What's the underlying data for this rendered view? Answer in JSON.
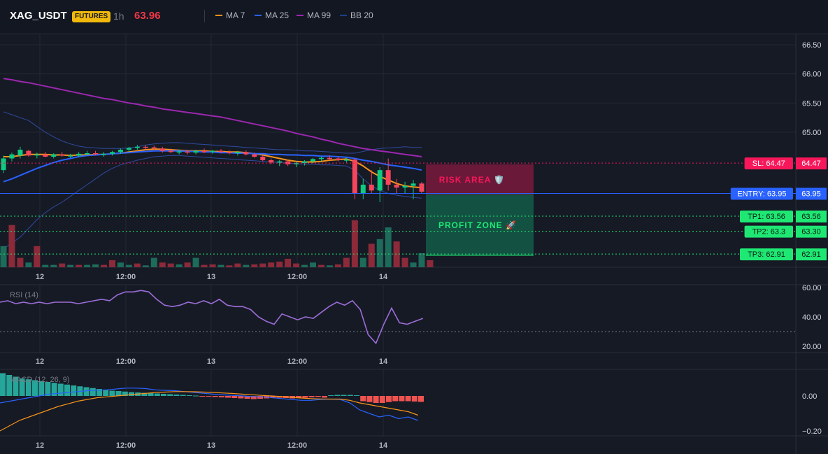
{
  "header": {
    "symbol": "XAG_USDT",
    "badge": "FUTURES",
    "timeframe": "1h",
    "price": "63.96",
    "legend": [
      {
        "label": "MA 7",
        "color": "#f7931a"
      },
      {
        "label": "MA 25",
        "color": "#2962ff"
      },
      {
        "label": "MA 99",
        "color": "#9c27b0"
      },
      {
        "label": "BB 20",
        "color": "#1e3f8a"
      }
    ]
  },
  "overlays": {
    "risk_label": "RISK AREA 🛡️",
    "profit_label": "PROFIT ZONE 🚀"
  },
  "levels": [
    {
      "label": "SL: 64.47",
      "price_label": "64.47",
      "value": 64.47,
      "color": "#f7175a"
    },
    {
      "label": "ENTRY: 63.95",
      "price_label": "63.95",
      "value": 63.95,
      "color": "#2962ff"
    },
    {
      "label": "TP1: 63.56",
      "price_label": "63.56",
      "value": 63.56,
      "color": "#1ee873"
    },
    {
      "label": "TP2: 63.3",
      "price_label": "63.30",
      "value": 63.3,
      "color": "#1ee873"
    },
    {
      "label": "TP3: 62.91",
      "price_label": "62.91",
      "value": 62.91,
      "color": "#1ee873"
    }
  ],
  "chart_data": [
    {
      "type": "candlestick",
      "title": "XAG_USDT 1h",
      "y_ticks": [
        "66.50",
        "66.00",
        "65.50",
        "65.00"
      ],
      "x_ticks": [
        "12",
        "12:00",
        "13",
        "12:00",
        "14"
      ],
      "ylim": [
        62.9,
        66.7
      ],
      "candles": [
        {
          "o": 64.35,
          "h": 64.6,
          "l": 64.3,
          "c": 64.55
        },
        {
          "o": 64.55,
          "h": 64.65,
          "l": 64.5,
          "c": 64.62
        },
        {
          "o": 64.6,
          "h": 64.75,
          "l": 64.55,
          "c": 64.7
        },
        {
          "o": 64.68,
          "h": 64.7,
          "l": 64.58,
          "c": 64.6
        },
        {
          "o": 64.6,
          "h": 64.65,
          "l": 64.55,
          "c": 64.62
        },
        {
          "o": 64.62,
          "h": 64.66,
          "l": 64.57,
          "c": 64.58
        },
        {
          "o": 64.58,
          "h": 64.64,
          "l": 64.55,
          "c": 64.62
        },
        {
          "o": 64.62,
          "h": 64.66,
          "l": 64.58,
          "c": 64.6
        },
        {
          "o": 64.6,
          "h": 64.63,
          "l": 64.56,
          "c": 64.6
        },
        {
          "o": 64.6,
          "h": 64.66,
          "l": 64.57,
          "c": 64.63
        },
        {
          "o": 64.63,
          "h": 64.68,
          "l": 64.6,
          "c": 64.64
        },
        {
          "o": 64.64,
          "h": 64.68,
          "l": 64.6,
          "c": 64.62
        },
        {
          "o": 64.62,
          "h": 64.66,
          "l": 64.58,
          "c": 64.63
        },
        {
          "o": 64.63,
          "h": 64.68,
          "l": 64.6,
          "c": 64.66
        },
        {
          "o": 64.66,
          "h": 64.72,
          "l": 64.63,
          "c": 64.7
        },
        {
          "o": 64.7,
          "h": 64.75,
          "l": 64.66,
          "c": 64.73
        },
        {
          "o": 64.73,
          "h": 64.78,
          "l": 64.7,
          "c": 64.75
        },
        {
          "o": 64.75,
          "h": 64.78,
          "l": 64.7,
          "c": 64.74
        },
        {
          "o": 64.74,
          "h": 64.77,
          "l": 64.7,
          "c": 64.72
        },
        {
          "o": 64.72,
          "h": 64.75,
          "l": 64.65,
          "c": 64.68
        },
        {
          "o": 64.68,
          "h": 64.72,
          "l": 64.64,
          "c": 64.66
        },
        {
          "o": 64.66,
          "h": 64.7,
          "l": 64.62,
          "c": 64.67
        },
        {
          "o": 64.67,
          "h": 64.7,
          "l": 64.62,
          "c": 64.65
        },
        {
          "o": 64.65,
          "h": 64.7,
          "l": 64.62,
          "c": 64.68
        },
        {
          "o": 64.68,
          "h": 64.72,
          "l": 64.64,
          "c": 64.66
        },
        {
          "o": 64.66,
          "h": 64.7,
          "l": 64.63,
          "c": 64.68
        },
        {
          "o": 64.68,
          "h": 64.71,
          "l": 64.64,
          "c": 64.66
        },
        {
          "o": 64.66,
          "h": 64.69,
          "l": 64.62,
          "c": 64.64
        },
        {
          "o": 64.64,
          "h": 64.68,
          "l": 64.6,
          "c": 64.66
        },
        {
          "o": 64.66,
          "h": 64.69,
          "l": 64.6,
          "c": 64.62
        },
        {
          "o": 64.62,
          "h": 64.65,
          "l": 64.56,
          "c": 64.58
        },
        {
          "o": 64.58,
          "h": 64.6,
          "l": 64.5,
          "c": 64.52
        },
        {
          "o": 64.52,
          "h": 64.55,
          "l": 64.45,
          "c": 64.48
        },
        {
          "o": 64.48,
          "h": 64.52,
          "l": 64.42,
          "c": 64.5
        },
        {
          "o": 64.5,
          "h": 64.53,
          "l": 64.42,
          "c": 64.45
        },
        {
          "o": 64.45,
          "h": 64.5,
          "l": 64.4,
          "c": 64.47
        },
        {
          "o": 64.47,
          "h": 64.52,
          "l": 64.43,
          "c": 64.5
        },
        {
          "o": 64.5,
          "h": 64.56,
          "l": 64.47,
          "c": 64.54
        },
        {
          "o": 64.54,
          "h": 64.58,
          "l": 64.5,
          "c": 64.56
        },
        {
          "o": 64.56,
          "h": 64.6,
          "l": 64.52,
          "c": 64.55
        },
        {
          "o": 64.55,
          "h": 64.58,
          "l": 64.5,
          "c": 64.52
        },
        {
          "o": 64.52,
          "h": 64.56,
          "l": 64.48,
          "c": 64.53
        },
        {
          "o": 64.53,
          "h": 64.55,
          "l": 63.85,
          "c": 63.95
        },
        {
          "o": 63.95,
          "h": 64.2,
          "l": 63.85,
          "c": 64.1
        },
        {
          "o": 64.1,
          "h": 64.35,
          "l": 63.95,
          "c": 64.0
        },
        {
          "o": 64.0,
          "h": 64.4,
          "l": 63.8,
          "c": 64.35
        },
        {
          "o": 64.35,
          "h": 64.55,
          "l": 64.0,
          "c": 64.1
        },
        {
          "o": 64.1,
          "h": 64.2,
          "l": 63.95,
          "c": 64.05
        },
        {
          "o": 64.05,
          "h": 64.15,
          "l": 63.95,
          "c": 64.08
        },
        {
          "o": 64.08,
          "h": 64.18,
          "l": 63.85,
          "c": 64.12
        },
        {
          "o": 64.12,
          "h": 64.15,
          "l": 63.95,
          "c": 63.98
        }
      ],
      "series": [
        {
          "name": "MA 7",
          "values": [
            64.58,
            64.58,
            64.6,
            64.62,
            64.62,
            64.62,
            64.61,
            64.61,
            64.6,
            64.61,
            64.61,
            64.62,
            64.62,
            64.63,
            64.64,
            64.66,
            64.68,
            64.7,
            64.71,
            64.71,
            64.7,
            64.69,
            64.68,
            64.68,
            64.68,
            64.67,
            64.67,
            64.66,
            64.66,
            64.65,
            64.63,
            64.61,
            64.58,
            64.55,
            64.52,
            64.5,
            64.49,
            64.49,
            64.5,
            64.52,
            64.53,
            64.54,
            64.5,
            64.42,
            64.32,
            64.24,
            64.18,
            64.12,
            64.08,
            64.06,
            64.05
          ]
        },
        {
          "name": "MA 25",
          "values": [
            64.15,
            64.2,
            64.26,
            64.32,
            64.38,
            64.43,
            64.48,
            64.52,
            64.55,
            64.58,
            64.6,
            64.61,
            64.62,
            64.63,
            64.64,
            64.65,
            64.66,
            64.67,
            64.68,
            64.68,
            64.68,
            64.68,
            64.67,
            64.67,
            64.66,
            64.66,
            64.65,
            64.65,
            64.64,
            64.64,
            64.63,
            64.63,
            64.62,
            64.62,
            64.61,
            64.61,
            64.6,
            64.6,
            64.59,
            64.59,
            64.58,
            64.57,
            64.55,
            64.52,
            64.5,
            64.47,
            64.44,
            64.42,
            64.4,
            64.38,
            64.35
          ]
        },
        {
          "name": "MA 99",
          "values": [
            65.92,
            65.9,
            65.87,
            65.85,
            65.82,
            65.79,
            65.76,
            65.73,
            65.7,
            65.67,
            65.64,
            65.61,
            65.58,
            65.56,
            65.53,
            65.5,
            65.48,
            65.45,
            65.43,
            65.4,
            65.38,
            65.36,
            65.34,
            65.32,
            65.3,
            65.28,
            65.26,
            65.23,
            65.2,
            65.17,
            65.14,
            65.11,
            65.08,
            65.05,
            65.02,
            64.98,
            64.95,
            64.92,
            64.88,
            64.85,
            64.81,
            64.78,
            64.75,
            64.72,
            64.7,
            64.68,
            64.66,
            64.64,
            64.62,
            64.6,
            64.58
          ]
        },
        {
          "name": "BB 20 upper",
          "values": [
            65.35,
            65.3,
            65.25,
            65.2,
            65.1,
            65.0,
            64.92,
            64.85,
            64.8,
            64.76,
            64.74,
            64.73,
            64.72,
            64.72,
            64.72,
            64.73,
            64.75,
            64.78,
            64.8,
            64.81,
            64.82,
            64.82,
            64.81,
            64.8,
            64.79,
            64.78,
            64.77,
            64.76,
            64.75,
            64.74,
            64.73,
            64.72,
            64.71,
            64.7,
            64.7,
            64.69,
            64.68,
            64.68,
            64.67,
            64.66,
            64.65,
            64.64,
            64.64,
            64.67,
            64.7,
            64.72,
            64.73,
            64.74,
            64.75,
            64.74,
            64.74
          ]
        },
        {
          "name": "BB 20 lower",
          "values": [
            63.0,
            63.1,
            63.2,
            63.35,
            63.5,
            63.62,
            63.72,
            63.8,
            63.9,
            64.0,
            64.1,
            64.2,
            64.3,
            64.38,
            64.44,
            64.48,
            64.52,
            64.55,
            64.58,
            64.59,
            64.6,
            64.6,
            64.59,
            64.58,
            64.57,
            64.56,
            64.55,
            64.54,
            64.53,
            64.52,
            64.51,
            64.5,
            64.49,
            64.48,
            64.47,
            64.46,
            64.45,
            64.45,
            64.44,
            64.44,
            64.43,
            64.42,
            64.35,
            64.2,
            64.08,
            64.0,
            63.95,
            63.92,
            63.9,
            63.88,
            63.87
          ]
        }
      ],
      "volume": [
        {
          "v": 0.45,
          "up": true
        },
        {
          "v": 0.9,
          "up": false
        },
        {
          "v": 0.2,
          "up": false
        },
        {
          "v": 0.1,
          "up": true
        },
        {
          "v": 0.45,
          "up": false
        },
        {
          "v": 0.05,
          "up": true
        },
        {
          "v": 0.05,
          "up": true
        },
        {
          "v": 0.08,
          "up": false
        },
        {
          "v": 0.05,
          "up": true
        },
        {
          "v": 0.05,
          "up": false
        },
        {
          "v": 0.05,
          "up": true
        },
        {
          "v": 0.06,
          "up": true
        },
        {
          "v": 0.05,
          "up": false
        },
        {
          "v": 0.15,
          "up": false
        },
        {
          "v": 0.1,
          "up": true
        },
        {
          "v": 0.05,
          "up": true
        },
        {
          "v": 0.08,
          "up": false
        },
        {
          "v": 0.04,
          "up": true
        },
        {
          "v": 0.2,
          "up": true
        },
        {
          "v": 0.1,
          "up": false
        },
        {
          "v": 0.08,
          "up": false
        },
        {
          "v": 0.06,
          "up": true
        },
        {
          "v": 0.1,
          "up": false
        },
        {
          "v": 0.2,
          "up": true
        },
        {
          "v": 0.05,
          "up": false
        },
        {
          "v": 0.06,
          "up": false
        },
        {
          "v": 0.05,
          "up": true
        },
        {
          "v": 0.04,
          "up": false
        },
        {
          "v": 0.08,
          "up": false
        },
        {
          "v": 0.05,
          "up": true
        },
        {
          "v": 0.06,
          "up": false
        },
        {
          "v": 0.08,
          "up": false
        },
        {
          "v": 0.1,
          "up": false
        },
        {
          "v": 0.12,
          "up": false
        },
        {
          "v": 0.18,
          "up": false
        },
        {
          "v": 0.08,
          "up": false
        },
        {
          "v": 0.05,
          "up": true
        },
        {
          "v": 0.1,
          "up": true
        },
        {
          "v": 0.05,
          "up": false
        },
        {
          "v": 0.04,
          "up": true
        },
        {
          "v": 0.06,
          "up": false
        },
        {
          "v": 0.2,
          "up": false
        },
        {
          "v": 1.0,
          "up": false
        },
        {
          "v": 0.2,
          "up": true
        },
        {
          "v": 0.5,
          "up": false
        },
        {
          "v": 0.6,
          "up": true
        },
        {
          "v": 0.85,
          "up": true
        },
        {
          "v": 0.55,
          "up": false
        },
        {
          "v": 0.2,
          "up": false
        },
        {
          "v": 0.1,
          "up": true
        },
        {
          "v": 0.3,
          "up": true
        },
        {
          "v": 0.15,
          "up": false
        }
      ]
    },
    {
      "type": "line",
      "title": "RSI (14)",
      "y_ticks": [
        "60.00",
        "40.00",
        "20.00"
      ],
      "x_ticks": [
        "12",
        "12:00",
        "13",
        "12:00",
        "14"
      ],
      "ylim": [
        15,
        64
      ],
      "values": [
        50,
        51,
        49,
        50,
        49,
        50,
        49,
        50,
        50,
        50,
        49,
        50,
        51,
        52,
        51,
        55,
        57,
        57,
        58,
        57,
        52,
        48,
        47,
        48,
        50,
        49,
        51,
        49,
        52,
        48,
        47,
        47,
        45,
        40,
        37,
        35,
        42,
        40,
        38,
        40,
        39,
        43,
        47,
        50,
        48,
        51,
        45,
        28,
        22,
        35,
        46,
        36,
        35,
        37,
        39
      ]
    },
    {
      "type": "bar",
      "title": "MACD (12, 26, 9)",
      "y_ticks": [
        "0.00",
        "−0.20"
      ],
      "x_ticks": [
        "12",
        "12:00",
        "13",
        "12:00",
        "14"
      ],
      "ylim": [
        -0.22,
        0.14
      ],
      "histogram": [
        0.13,
        0.12,
        0.11,
        0.1,
        0.095,
        0.09,
        0.085,
        0.08,
        0.075,
        0.07,
        0.065,
        0.06,
        0.055,
        0.05,
        0.045,
        0.04,
        0.035,
        0.03,
        0.028,
        0.025,
        0.022,
        0.02,
        0.018,
        0.016,
        0.014,
        0.012,
        0.01,
        0.008,
        0.006,
        0.004,
        0.002,
        -0.002,
        -0.004,
        -0.006,
        -0.008,
        -0.01,
        -0.012,
        -0.014,
        -0.016,
        -0.018,
        -0.016,
        -0.014,
        -0.012,
        -0.01,
        -0.012,
        -0.014,
        -0.012,
        -0.01,
        -0.008,
        -0.006,
        -0.01,
        0.004,
        0.006,
        0.006,
        0.006,
        0.004,
        -0.03,
        -0.035,
        -0.04,
        -0.04,
        -0.035,
        -0.03,
        -0.03,
        -0.03,
        -0.032,
        -0.034
      ],
      "series": [
        {
          "name": "MACD",
          "values": [
            -0.04,
            -0.03,
            -0.02,
            -0.01,
            0.0,
            0.01,
            0.015,
            0.02,
            0.025,
            0.03,
            0.033,
            0.035,
            0.04,
            0.045,
            0.045,
            0.042,
            0.035,
            0.032,
            0.03,
            0.025,
            0.02,
            0.015,
            0.01,
            0.006,
            0.003,
            0.0,
            -0.004,
            -0.005,
            -0.01,
            -0.015,
            -0.02,
            -0.025,
            -0.025,
            -0.02,
            -0.018,
            -0.02,
            -0.04,
            -0.08,
            -0.1,
            -0.12,
            -0.11,
            -0.13,
            -0.12,
            -0.14
          ]
        },
        {
          "name": "Signal",
          "values": [
            -0.2,
            -0.17,
            -0.14,
            -0.12,
            -0.1,
            -0.08,
            -0.06,
            -0.045,
            -0.03,
            -0.02,
            -0.01,
            -0.005,
            0.0,
            0.005,
            0.01,
            0.015,
            0.02,
            0.022,
            0.025,
            0.025,
            0.024,
            0.022,
            0.02,
            0.017,
            0.014,
            0.01,
            0.007,
            0.003,
            0.0,
            -0.004,
            -0.008,
            -0.012,
            -0.015,
            -0.017,
            -0.018,
            -0.018,
            -0.025,
            -0.04,
            -0.05,
            -0.06,
            -0.07,
            -0.08,
            -0.09,
            -0.11
          ]
        }
      ]
    }
  ]
}
